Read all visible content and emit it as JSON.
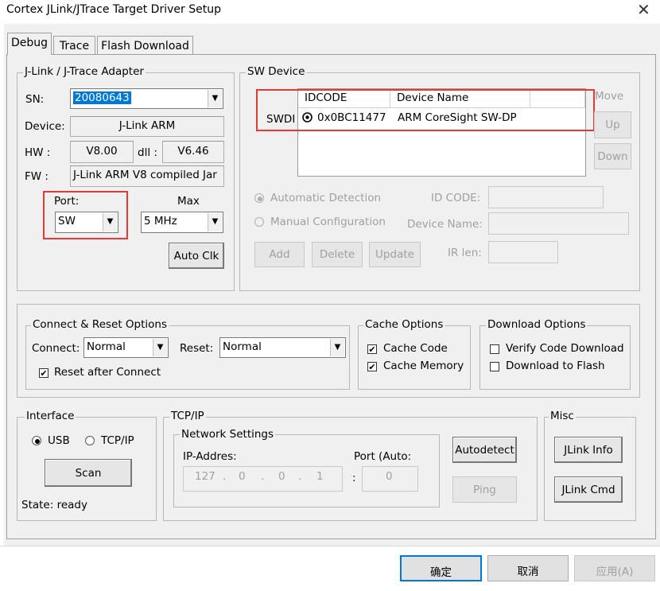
{
  "window": {
    "title": "Cortex JLink/JTrace Target Driver Setup",
    "close_glyph": "✕"
  },
  "tabs": [
    {
      "label": "Debug",
      "active": true
    },
    {
      "label": "Trace",
      "active": false
    },
    {
      "label": "Flash Download",
      "active": false
    }
  ],
  "adapter": {
    "group_label": "J-Link / J-Trace Adapter",
    "sn_label": "SN:",
    "sn_value": "20080643",
    "device_label": "Device:",
    "device_value": "J-Link ARM",
    "hw_label": "HW :",
    "hw_value": "V8.00",
    "dll_label": "dll :",
    "dll_value": "V6.46",
    "fw_label": "FW :",
    "fw_value": "J-Link ARM V8 compiled Jar",
    "port_label": "Port:",
    "port_value": "SW",
    "max_label": "Max",
    "max_value": "5 MHz",
    "autoclk_label": "Auto Clk"
  },
  "sw_device": {
    "group_label": "SW Device",
    "row_label": "SWDI",
    "columns": [
      "IDCODE",
      "Device Name"
    ],
    "rows": [
      {
        "idcode": "0x0BC11477",
        "device_name": "ARM CoreSight SW-DP"
      }
    ],
    "move_label": "Move",
    "up_label": "Up",
    "down_label": "Down",
    "auto_detect_label": "Automatic Detection",
    "manual_config_label": "Manual Configuration",
    "id_code_label": "ID CODE:",
    "device_name_label": "Device Name:",
    "ir_len_label": "IR len:",
    "add_label": "Add",
    "delete_label": "Delete",
    "update_label": "Update"
  },
  "connect_reset": {
    "group_label": "Connect & Reset Options",
    "connect_label": "Connect:",
    "connect_value": "Normal",
    "reset_label": "Reset:",
    "reset_value": "Normal",
    "reset_after_connect_label": "Reset after Connect",
    "reset_after_connect_checked": true
  },
  "cache": {
    "group_label": "Cache Options",
    "cache_code_label": "Cache Code",
    "cache_code_checked": true,
    "cache_memory_label": "Cache Memory",
    "cache_memory_checked": true
  },
  "download": {
    "group_label": "Download Options",
    "verify_label": "Verify Code Download",
    "verify_checked": false,
    "flash_label": "Download to Flash",
    "flash_checked": false
  },
  "interface": {
    "group_label": "Interface",
    "usb_label": "USB",
    "usb_selected": true,
    "tcpip_label": "TCP/IP",
    "scan_label": "Scan",
    "state_text": "State: ready"
  },
  "tcpip": {
    "group_label": "TCP/IP",
    "network_label": "Network Settings",
    "ip_label": "IP-Addres:",
    "ip_parts": [
      "127",
      "0",
      "0",
      "1"
    ],
    "ip_dot": ".",
    "port_label": "Port (Auto:",
    "port_colon": ":",
    "port_value": "0",
    "autodetect_label": "Autodetect",
    "ping_label": "Ping"
  },
  "misc": {
    "group_label": "Misc",
    "jlink_info_label": "JLink Info",
    "jlink_cmd_label": "JLink Cmd"
  },
  "footer": {
    "ok_label": "确定",
    "cancel_label": "取消",
    "apply_label": "应用(A)"
  },
  "colors": {
    "highlight_red": "#e53935",
    "selection_blue": "#0078d7",
    "dialog_bg": "#f0f0f0"
  }
}
